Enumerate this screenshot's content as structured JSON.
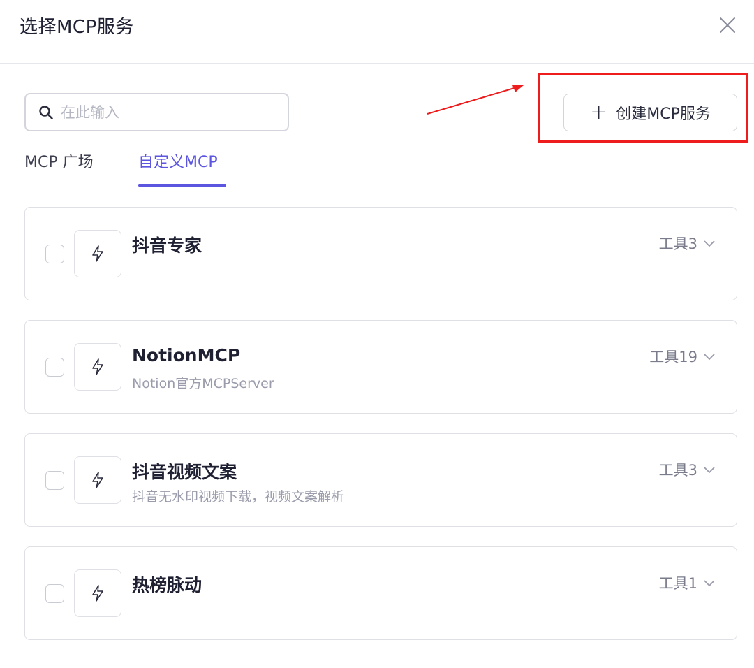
{
  "dialog": {
    "title": "选择MCP服务"
  },
  "search": {
    "placeholder": "在此输入"
  },
  "create_button": {
    "label": "创建MCP服务"
  },
  "tabs": [
    {
      "label": "MCP 广场",
      "active": false
    },
    {
      "label": "自定义MCP",
      "active": true
    }
  ],
  "services": [
    {
      "name": "抖音专家",
      "description": "",
      "tools": "工具3"
    },
    {
      "name": "NotionMCP",
      "description": "Notion官方MCPServer",
      "tools": "工具19"
    },
    {
      "name": "抖音视频文案",
      "description": "抖音无水印视频下载，视频文案解析",
      "tools": "工具3"
    },
    {
      "name": "热榜脉动",
      "description": "",
      "tools": "工具1"
    }
  ],
  "colors": {
    "accent": "#5b55e0",
    "annotation": "#ee1c1c",
    "border": "#dfe0e6"
  },
  "icons": [
    "search-icon",
    "close-icon",
    "plus-icon",
    "lightning-icon",
    "chevron-down-icon"
  ]
}
